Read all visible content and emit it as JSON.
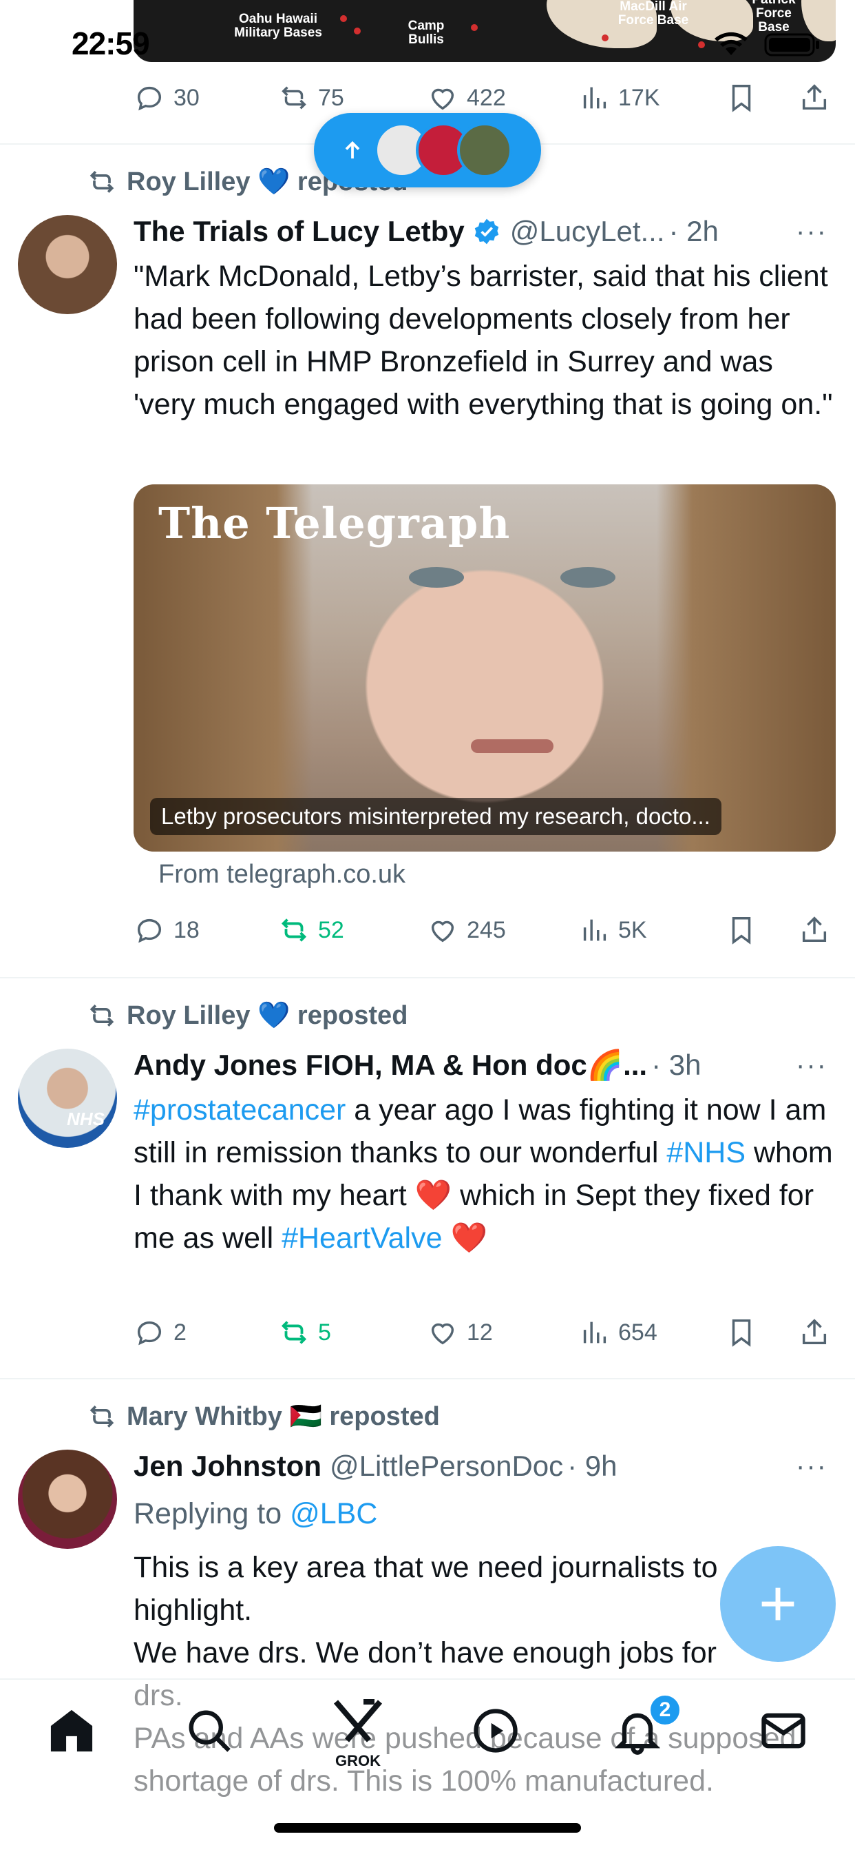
{
  "status": {
    "time": "22:59"
  },
  "map_labels": [
    "Oahu Hawaii Military Bases",
    "Camp Bullis",
    "MacDill Air Force Base",
    "Patrick Force Base"
  ],
  "top_stats": {
    "replies": "30",
    "reposts": "75",
    "likes": "422",
    "views": "17K"
  },
  "tweets": [
    {
      "reposted_by": "Roy Lilley 💙 reposted",
      "display_name": "The Trials of Lucy Letby",
      "handle": "@LucyLet...",
      "time": "· 2h",
      "more": "···",
      "text": "\"Mark McDonald, Letby’s barrister, said that his client had been following developments closely from her prison cell in HMP Bronzefield in Surrey and was 'very much engaged with everything that is going on.\"",
      "card_logo": "The Telegraph",
      "card_caption": "Letby prosecutors misinterpreted my research, docto...",
      "card_source": "From telegraph.co.uk",
      "stats": {
        "replies": "18",
        "reposts": "52",
        "likes": "245",
        "views": "5K"
      }
    },
    {
      "reposted_by": "Roy Lilley 💙 reposted",
      "display_name": "Andy Jones FIOH, MA & Hon doc🌈...",
      "time": "· 3h",
      "more": "···",
      "text_parts": [
        "#prostatecancer",
        " a year ago I was fighting  it now I am still in remission thanks to our wonderful ",
        "#NHS",
        " whom I thank with my heart ❤️ which in Sept they fixed for me as well ",
        "#HeartValve",
        " ❤️"
      ],
      "avatar_badge": "NHS",
      "stats": {
        "replies": "2",
        "reposts": "5",
        "likes": "12",
        "views": "654"
      }
    },
    {
      "reposted_by": "Mary Whitby 🇵🇸 reposted",
      "display_name": "Jen Johnston",
      "handle": "@LittlePersonDoc",
      "time": "· 9h",
      "more": "···",
      "replying_prefix": "Replying to ",
      "replying_to": "@LBC",
      "text_line1": "This is a key area that we need journalists to highlight.",
      "text_line2": "We have drs. We don’t have enough jobs for",
      "text_line3": "drs.",
      "text_line4": "PAs and AAs were pushed because of a supposed shortage of drs. This is 100% manufactured."
    }
  ],
  "fab_label": "+",
  "nav": {
    "grok_label": "GROK",
    "notif_badge": "2"
  },
  "colors": {
    "accent": "#1d9bf0",
    "repost_green": "#00ba7c",
    "muted": "#536471"
  }
}
